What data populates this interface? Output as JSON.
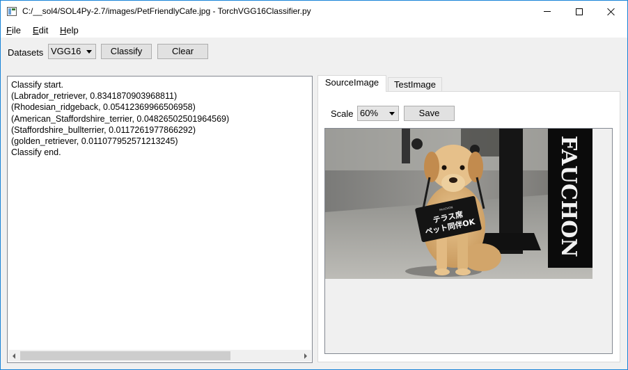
{
  "window": {
    "title": "C:/__sol4/SOL4Py-2.7/images/PetFriendlyCafe.jpg - TorchVGG16Classifier.py"
  },
  "menu": {
    "file": {
      "key": "F",
      "rest": "ile"
    },
    "edit": {
      "key": "E",
      "rest": "dit"
    },
    "help": {
      "key": "H",
      "rest": "elp"
    }
  },
  "toolbar": {
    "datasets_label": "Datasets",
    "datasets_value": "VGG16",
    "classify_label": "Classify",
    "clear_label": "Clear"
  },
  "log": {
    "lines": [
      "Classify start.",
      "(Labrador_retriever,  0.8341870903968811)",
      "(Rhodesian_ridgeback,  0.05412369966506958)",
      "(American_Staffordshire_terrier,  0.04826502501964569)",
      "(Staffordshire_bullterrier,  0.0117261977866292)",
      "(golden_retriever,  0.011077952571213245)",
      "Classify end."
    ]
  },
  "tabs": {
    "source": "SourceImage",
    "test": "TestImage"
  },
  "image_controls": {
    "scale_label": "Scale",
    "scale_value": "60%",
    "save_label": "Save"
  },
  "image": {
    "sign_line1": "テラス席",
    "sign_line2": "ペット同伴OK",
    "sign_brand": "FAUCHON",
    "wall_text": "FAUCHON"
  }
}
